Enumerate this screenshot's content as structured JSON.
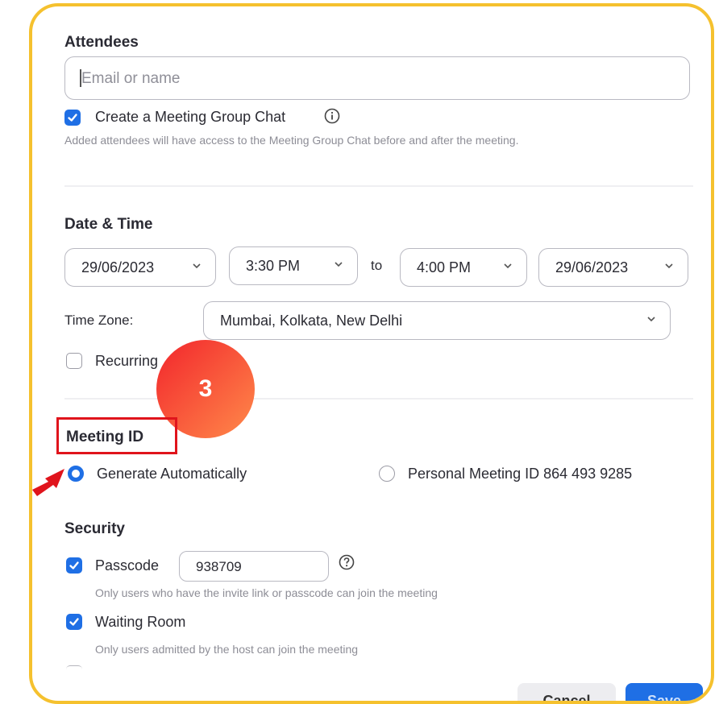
{
  "attendees": {
    "title": "Attendees",
    "placeholder": "Email or name",
    "group_chat_label": "Create a Meeting Group Chat",
    "group_chat_checked": true,
    "group_chat_hint": "Added attendees will have access to the Meeting Group Chat before and after the meeting."
  },
  "datetime": {
    "title": "Date & Time",
    "start_date": "29/06/2023",
    "start_time": "3:30 PM",
    "to_label": "to",
    "end_time": "4:00 PM",
    "end_date": "29/06/2023",
    "timezone_label": "Time Zone:",
    "timezone_value": "Mumbai, Kolkata, New Delhi",
    "recurring_label": "Recurring",
    "recurring_checked": false
  },
  "annotation": {
    "step_number": "3"
  },
  "meeting_id": {
    "title": "Meeting ID",
    "option_auto": "Generate Automatically",
    "option_personal": "Personal Meeting ID 864 493 9285",
    "selected": "auto"
  },
  "security": {
    "title": "Security",
    "passcode_label": "Passcode",
    "passcode_checked": true,
    "passcode_value": "938709",
    "passcode_hint": "Only users who have the invite link or passcode can join the meeting",
    "waiting_room_label": "Waiting Room",
    "waiting_room_checked": true,
    "waiting_room_hint": "Only users admitted by the host can join the meeting"
  },
  "footer": {
    "cancel_label": "Cancel",
    "save_label": "Save"
  },
  "colors": {
    "frame_border": "#f5c12e",
    "accent_blue": "#1f6fe5",
    "annotation_red": "#e0141c"
  }
}
